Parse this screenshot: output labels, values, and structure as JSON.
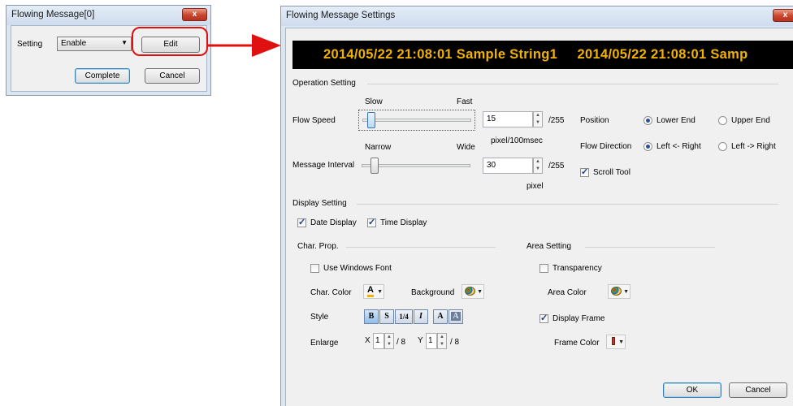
{
  "small_dialog": {
    "title": "Flowing Message[0]",
    "close_glyph": "x",
    "setting_label": "Setting",
    "setting_value": "Enable",
    "edit_label": "Edit",
    "complete_label": "Complete",
    "cancel_label": "Cancel"
  },
  "annotation": {
    "highlight_color": "#e01010"
  },
  "settings_dialog": {
    "title": "Flowing Message Settings",
    "close_glyph": "x",
    "preview_text": "2014/05/22 21:08:01 Sample String1     2014/05/22 21:08:01 Samp",
    "preview_colors": {
      "background": "#000000",
      "text": "#f2b300"
    },
    "operation": {
      "section_label": "Operation Setting",
      "flow_speed_label": "Flow Speed",
      "slow_label": "Slow",
      "fast_label": "Fast",
      "flow_speed_value": "15",
      "flow_speed_max": "/255",
      "flow_speed_unit": "pixel/100msec",
      "narrow_label": "Narrow",
      "wide_label": "Wide",
      "message_interval_label": "Message Interval",
      "message_interval_value": "30",
      "message_interval_max": "/255",
      "message_interval_unit": "pixel",
      "position_label": "Position",
      "position_lower": "Lower End",
      "position_upper": "Upper End",
      "flow_direction_label": "Flow Direction",
      "direction_left_right": "Left <- Right",
      "direction_left_to_right": "Left -> Right",
      "scroll_tool_label": "Scroll Tool"
    },
    "display": {
      "section_label": "Display Setting",
      "date_display": "Date Display",
      "time_display": "Time Display"
    },
    "char_prop": {
      "section_label": "Char. Prop.",
      "use_windows_font": "Use Windows Font",
      "char_color_label": "Char. Color",
      "background_label": "Background",
      "style_label": "Style",
      "style_buttons": [
        "B",
        "S",
        "1/4",
        "I",
        "A",
        "A"
      ],
      "enlarge_label": "Enlarge",
      "x_label": "X",
      "x_value": "1",
      "x_denominator": "/ 8",
      "y_label": "Y",
      "y_value": "1",
      "y_denominator": "/ 8"
    },
    "area": {
      "section_label": "Area Setting",
      "transparency_label": "Transparency",
      "area_color_label": "Area Color",
      "display_frame_label": "Display Frame",
      "frame_color_label": "Frame Color"
    },
    "ok_label": "OK",
    "cancel_label": "Cancel"
  }
}
